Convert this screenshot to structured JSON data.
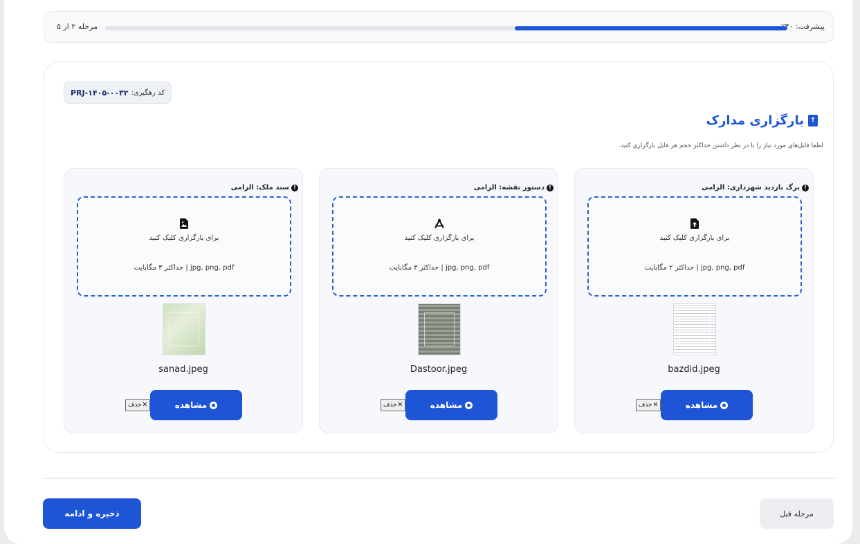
{
  "progress": {
    "label": "پیشرفت: ۴۰٪",
    "percent": 40,
    "step_text": "مرحله ۲ از ۵"
  },
  "tracking": {
    "label": "کد رهگیری:",
    "code": "PRJ-۱۴۰۵-۰۰۳۲"
  },
  "section": {
    "title": "بارگزاری مدارک",
    "description": "لطفا فایل‌های مورد نیاز را با در نظر داشتن حداکثر حجم هر فایل بارگزاری کنید."
  },
  "documents": [
    {
      "label": "برگ بازدید شهرداری: الزامی",
      "icon": "file-upload-icon",
      "upload_text": "برای بارگزاری کلیک کنید",
      "hint": "jpg, png, pdf | حداکثر ۲ مگابایت",
      "filename": "bazdid.jpeg",
      "view_label": "مشاهده",
      "delete_label": "حذف"
    },
    {
      "label": "دستور نقشه: الزامی",
      "icon": "compass-drafting-icon",
      "upload_text": "برای بارگزاری کلیک کنید",
      "hint": "jpg, png, pdf | حداکثر ۳ مگابایت",
      "filename": "Dastoor.jpeg",
      "view_label": "مشاهده",
      "delete_label": "حذف"
    },
    {
      "label": "سند ملک: الزامی",
      "icon": "file-image-icon",
      "upload_text": "برای بارگزاری کلیک کنید",
      "hint": "jpg, png, pdf | حداکثر ۳ مگابایت",
      "filename": "sanad.jpeg",
      "view_label": "مشاهده",
      "delete_label": "حذف"
    }
  ],
  "footer": {
    "next_label": "ذخیره و ادامه",
    "prev_label": "مرحله قبل"
  },
  "colors": {
    "accent": "#1d55d6",
    "dashed_border": "#2b5fd1"
  }
}
